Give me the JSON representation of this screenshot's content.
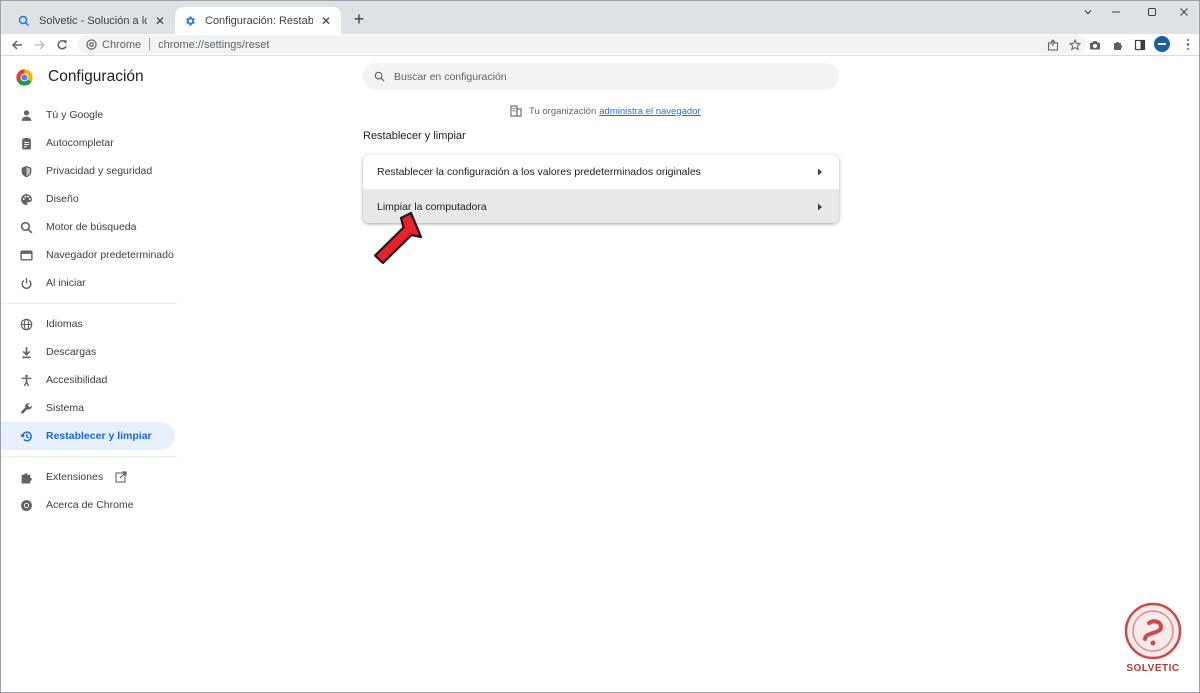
{
  "tabs": [
    {
      "title": "Solvetic - Solución a los problemas",
      "icon": "search-favicon-icon"
    },
    {
      "title": "Configuración: Restablecer y limpiar",
      "icon": "settings-favicon-icon"
    }
  ],
  "window_controls": {
    "close_tab": "✕",
    "new_tab": "+"
  },
  "omnibox": {
    "chip_label": "Chrome",
    "url": "chrome://settings/reset"
  },
  "settings": {
    "title": "Configuración",
    "search_placeholder": "Buscar en configuración",
    "managed_text": "Tu organización",
    "managed_link": "administra el navegador",
    "section_title": "Restablecer y limpiar"
  },
  "sidebar": {
    "group1": [
      {
        "label": "Tú y Google",
        "icon": "person-icon"
      },
      {
        "label": "Autocompletar",
        "icon": "clipboard-icon"
      },
      {
        "label": "Privacidad y seguridad",
        "icon": "shield-icon"
      },
      {
        "label": "Diseño",
        "icon": "palette-icon"
      },
      {
        "label": "Motor de búsqueda",
        "icon": "search-icon"
      },
      {
        "label": "Navegador predeterminado",
        "icon": "browser-icon"
      },
      {
        "label": "Al iniciar",
        "icon": "power-icon"
      }
    ],
    "group2": [
      {
        "label": "Idiomas",
        "icon": "globe-icon"
      },
      {
        "label": "Descargas",
        "icon": "download-icon"
      },
      {
        "label": "Accesibilidad",
        "icon": "accessibility-icon"
      },
      {
        "label": "Sistema",
        "icon": "wrench-icon"
      },
      {
        "label": "Restablecer y limpiar",
        "icon": "restore-icon",
        "active": true
      }
    ],
    "group3": [
      {
        "label": "Extensiones",
        "icon": "puzzle-icon"
      },
      {
        "label": "Acerca de Chrome",
        "icon": "chrome-icon"
      }
    ]
  },
  "reset_rows": [
    {
      "label": "Restablecer la configuración a los valores predeterminados originales"
    },
    {
      "label": "Limpiar la computadora"
    }
  ],
  "colors": {
    "accent": "#1967d2",
    "active_bg": "#e8f0fe",
    "pointer": "#e8212b",
    "watermark": "#b23b3b"
  }
}
